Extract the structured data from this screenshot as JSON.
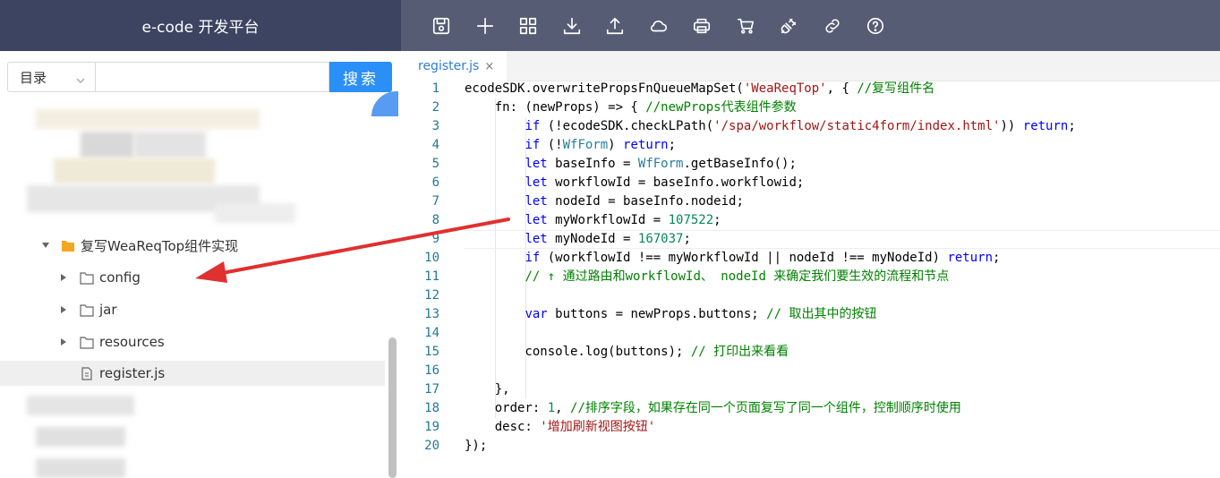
{
  "app": {
    "title": "e-code 开发平台"
  },
  "toolbar": {
    "icons": [
      "save-icon",
      "add-icon",
      "grid-icon",
      "download-icon",
      "upload-icon",
      "cloud-icon",
      "print-icon",
      "cart-icon",
      "plug-icon",
      "link-icon",
      "help-icon"
    ]
  },
  "sidebar": {
    "directory_select": "目录",
    "search_placeholder": "",
    "search_button": "搜索",
    "tree": {
      "folder_label": "复写WeaReqTop组件实现",
      "children": [
        {
          "label": "config",
          "kind": "folder"
        },
        {
          "label": "jar",
          "kind": "folder"
        },
        {
          "label": "resources",
          "kind": "folder"
        },
        {
          "label": "register.js",
          "kind": "file",
          "selected": true
        }
      ]
    }
  },
  "editor": {
    "tab": {
      "label": "register.js",
      "close": "×"
    },
    "line_numbers": [
      "1",
      "2",
      "3",
      "4",
      "5",
      "6",
      "7",
      "8",
      "9",
      "10",
      "11",
      "12",
      "13",
      "14",
      "15",
      "16",
      "17",
      "18",
      "19",
      "20"
    ],
    "code_lines": [
      "ecodeSDK.overwritePropsFnQueueMapSet('WeaReqTop', { //复写组件名",
      "    fn: (newProps) => { //newProps代表组件参数",
      "        if (!ecodeSDK.checkLPath('/spa/workflow/static4form/index.html')) return;",
      "        if (!WfForm) return;",
      "        let baseInfo = WfForm.getBaseInfo();",
      "        let workflowId = baseInfo.workflowid;",
      "        let nodeId = baseInfo.nodeid;",
      "        let myWorkflowId = 107522;",
      "        let myNodeId = 167037;",
      "        if (workflowId !== myWorkflowId || nodeId !== myNodeId) return;",
      "        // ↑ 通过路由和workflowId、 nodeId 来确定我们要生效的流程和节点",
      "",
      "        var buttons = newProps.buttons; // 取出其中的按钮",
      "",
      "        console.log(buttons); // 打印出来看看",
      "",
      "    },",
      "    order: 1, //排序字段，如果存在同一个页面复写了同一个组件，控制顺序时使用",
      "    desc: '增加刷新视图按钮'",
      "});"
    ]
  },
  "colors": {
    "accent": "#2b8ff8",
    "topbar_left": "#3c4461",
    "topbar_right": "#555c74",
    "arrow": "#e03030"
  }
}
